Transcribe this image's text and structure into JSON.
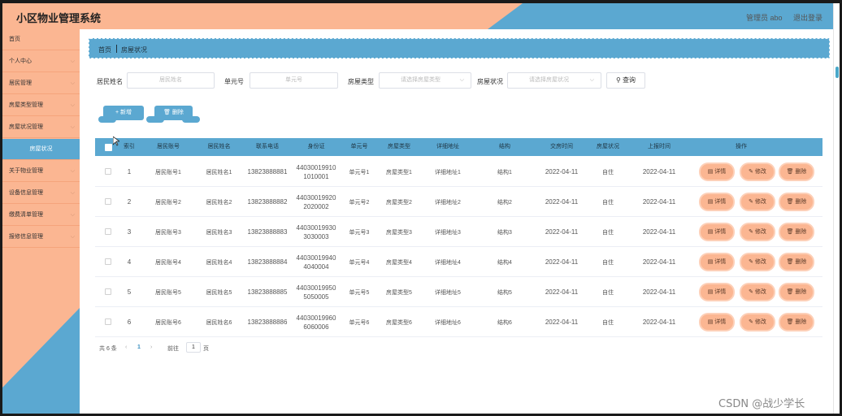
{
  "header": {
    "title": "小区物业管理系统",
    "user": "管理员 abo",
    "logout": "退出登录",
    "colors": {
      "peach": "#fbb692",
      "blue": "#5ba8d1"
    }
  },
  "sidebar": {
    "items": [
      {
        "label": "首页",
        "chevron": false
      },
      {
        "label": "个人中心",
        "chevron": true
      },
      {
        "label": "居民管理",
        "chevron": true
      },
      {
        "label": "房屋类型管理",
        "chevron": true
      },
      {
        "label": "房屋状况管理",
        "chevron": true
      },
      {
        "label": "房屋状况",
        "chevron": false,
        "sub": true,
        "active": true
      },
      {
        "label": "关于物业管理",
        "chevron": true
      },
      {
        "label": "设备信息管理",
        "chevron": true
      },
      {
        "label": "缴费清单管理",
        "chevron": true
      },
      {
        "label": "报修信息管理",
        "chevron": true
      }
    ]
  },
  "breadcrumb": {
    "home": "首页",
    "current": "房屋状况"
  },
  "filters": {
    "name_label": "居民姓名",
    "name_placeholder": "居民姓名",
    "unit_label": "单元号",
    "unit_placeholder": "单元号",
    "type_label": "房屋类型",
    "type_placeholder": "请选择房屋类型",
    "status_label": "房屋状况",
    "status_placeholder": "请选择房屋状况",
    "search_label": "查询",
    "search_icon": "search-icon"
  },
  "actions": {
    "add_label": "新增",
    "delete_label": "删除"
  },
  "table": {
    "columns": [
      "索引",
      "居民账号",
      "居民姓名",
      "联系电话",
      "身份证",
      "单元号",
      "房屋类型",
      "详细地址",
      "结构",
      "交房时间",
      "房屋状况",
      "上报时间",
      "操作"
    ],
    "rows": [
      {
        "index": "1",
        "account": "居民账号1",
        "name": "居民姓名1",
        "phone": "13823888881",
        "id_line1": "44030019910",
        "id_line2": "1010001",
        "unit": "单元号1",
        "type": "房屋类型1",
        "address": "详细地址1",
        "structure": "结构1",
        "handover": "2022-04-11",
        "status": "自住",
        "reported": "2022-04-11"
      },
      {
        "index": "2",
        "account": "居民账号2",
        "name": "居民姓名2",
        "phone": "13823888882",
        "id_line1": "44030019920",
        "id_line2": "2020002",
        "unit": "单元号2",
        "type": "房屋类型2",
        "address": "详细地址2",
        "structure": "结构2",
        "handover": "2022-04-11",
        "status": "自住",
        "reported": "2022-04-11"
      },
      {
        "index": "3",
        "account": "居民账号3",
        "name": "居民姓名3",
        "phone": "13823888883",
        "id_line1": "44030019930",
        "id_line2": "3030003",
        "unit": "单元号3",
        "type": "房屋类型3",
        "address": "详细地址3",
        "structure": "结构3",
        "handover": "2022-04-11",
        "status": "自住",
        "reported": "2022-04-11"
      },
      {
        "index": "4",
        "account": "居民账号4",
        "name": "居民姓名4",
        "phone": "13823888884",
        "id_line1": "44030019940",
        "id_line2": "4040004",
        "unit": "单元号4",
        "type": "房屋类型4",
        "address": "详细地址4",
        "structure": "结构4",
        "handover": "2022-04-11",
        "status": "自住",
        "reported": "2022-04-11"
      },
      {
        "index": "5",
        "account": "居民账号5",
        "name": "居民姓名5",
        "phone": "13823888885",
        "id_line1": "44030019950",
        "id_line2": "5050005",
        "unit": "单元号5",
        "type": "房屋类型5",
        "address": "详细地址5",
        "structure": "结构5",
        "handover": "2022-04-11",
        "status": "自住",
        "reported": "2022-04-11"
      },
      {
        "index": "6",
        "account": "居民账号6",
        "name": "居民姓名6",
        "phone": "13823888886",
        "id_line1": "44030019960",
        "id_line2": "6060006",
        "unit": "单元号6",
        "type": "房屋类型6",
        "address": "详细地址6",
        "structure": "结构6",
        "handover": "2022-04-11",
        "status": "自住",
        "reported": "2022-04-11"
      }
    ],
    "row_actions": {
      "detail": "详情",
      "edit": "修改",
      "delete": "删除"
    }
  },
  "pagination": {
    "total": "共 6 条",
    "prev": "‹",
    "current": "1",
    "next": "›",
    "goto": "前往",
    "page_value": "1",
    "page_unit": "页"
  },
  "watermark": "CSDN @战少学长"
}
